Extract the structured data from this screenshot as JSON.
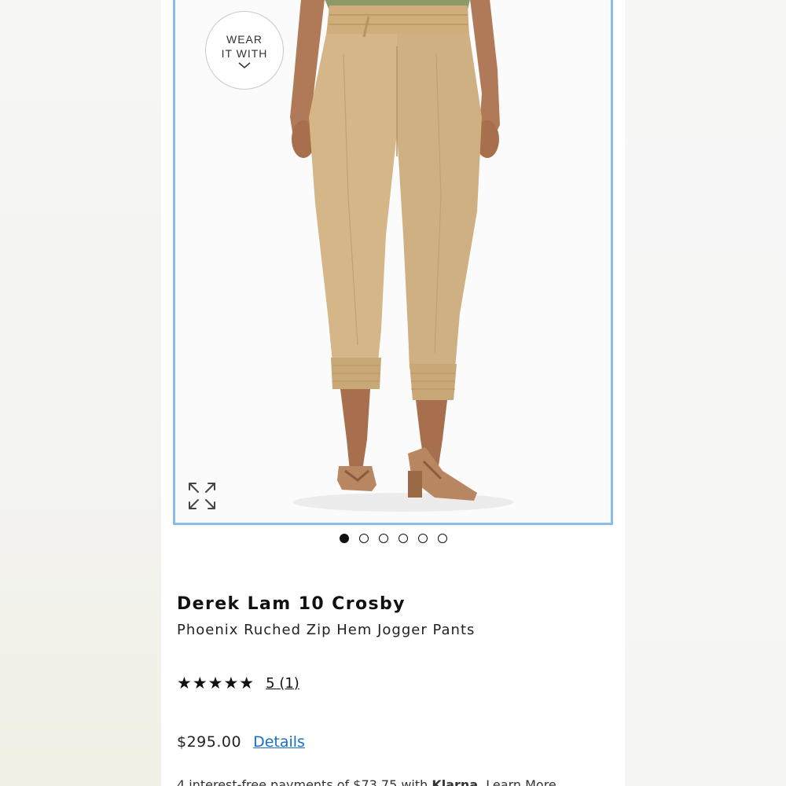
{
  "badge": {
    "line1": "WEAR",
    "line2": "IT WITH",
    "icon": "chevron-down-icon"
  },
  "gallery": {
    "image_count": 6,
    "active_index": 0,
    "expand_icon": "expand-icon"
  },
  "product": {
    "brand": "Derek Lam 10 Crosby",
    "name": "Phoenix Ruched Zip Hem Jogger Pants",
    "stars": "★★★★★",
    "rating_value": 5,
    "rating_link": "5 (1)",
    "price": "$295.00",
    "details_label": "Details"
  },
  "installments": {
    "prefix": "4 interest-free payments of $73.75 with ",
    "provider": "Klarna",
    "suffix": ". ",
    "learn_more": "Learn More"
  },
  "colors": {
    "frame_border": "#8bbcea",
    "link_blue": "#1a6fc4",
    "pants_khaki": "#d4b688"
  }
}
